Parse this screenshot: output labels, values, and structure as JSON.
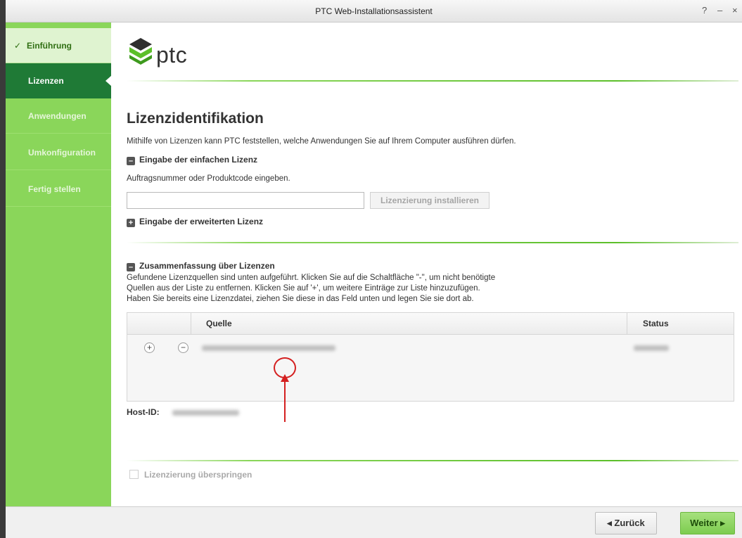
{
  "window": {
    "title": "PTC Web-Installationsassistent",
    "help_glyph": "?",
    "minimize_glyph": "–",
    "close_glyph": "×"
  },
  "sidebar": {
    "items": [
      {
        "label": "Einführung",
        "state": "done"
      },
      {
        "label": "Lizenzen",
        "state": "active"
      },
      {
        "label": "Anwendungen",
        "state": "future"
      },
      {
        "label": "Umkonfiguration",
        "state": "future"
      },
      {
        "label": "Fertig stellen",
        "state": "future"
      }
    ],
    "check_glyph": "✓"
  },
  "logo": {
    "text": "ptc"
  },
  "main": {
    "title": "Lizenzidentifikation",
    "intro": "Mithilfe von Lizenzen kann PTC feststellen, welche Anwendungen Sie auf Ihrem Computer ausführen dürfen.",
    "simple_section": {
      "toggle": "–",
      "label": "Eingabe der einfachen Lizenz"
    },
    "input_prompt": "Auftragsnummer oder Produktcode eingeben.",
    "input_value": "",
    "install_button": "Lizenzierung installieren",
    "advanced_section": {
      "toggle": "+",
      "label": "Eingabe der erweiterten Lizenz"
    },
    "summary_section": {
      "toggle": "–",
      "label": "Zusammenfassung über Lizenzen"
    },
    "summary_text": [
      "Gefundene Lizenzquellen sind unten aufgeführt. Klicken Sie auf die Schaltfläche \"-\", um nicht benötigte",
      "Quellen aus der Liste zu entfernen. Klicken Sie auf '+', um weitere Einträge zur Liste hinzuzufügen.",
      " Haben Sie bereits eine Lizenzdatei, ziehen Sie diese in das Feld unten und legen Sie sie dort ab."
    ],
    "table": {
      "headers": {
        "source": "Quelle",
        "status": "Status"
      },
      "row": {
        "add_glyph": "+",
        "remove_glyph": "−"
      }
    },
    "host_label": "Host-ID:",
    "skip_checkbox": "Lizenzierung überspringen"
  },
  "footer": {
    "back_button": "◂ Zurück",
    "next_button": "Weiter ▸"
  },
  "colors": {
    "accent_green": "#8ad65a",
    "active_green": "#1f7a36",
    "annotation_red": "#d42020"
  }
}
